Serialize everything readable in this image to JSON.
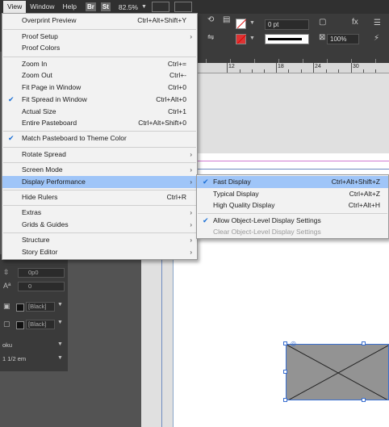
{
  "menubar": {
    "items": [
      "View",
      "Window",
      "Help"
    ],
    "badges": [
      "Br",
      "St"
    ],
    "zoom": "82.5%"
  },
  "controlbar": {
    "stroke_weight": "0 pt",
    "scale_pct": "100%"
  },
  "ruler": {
    "labels": [
      "12",
      "18",
      "24",
      "30"
    ]
  },
  "view_menu": [
    {
      "label": "Overprint Preview",
      "shortcut": "Ctrl+Alt+Shift+Y"
    },
    {
      "label": "Proof Setup",
      "submenu": true
    },
    {
      "label": "Proof Colors"
    },
    {
      "label": "Zoom In",
      "shortcut": "Ctrl+="
    },
    {
      "label": "Zoom Out",
      "shortcut": "Ctrl+-"
    },
    {
      "label": "Fit Page in Window",
      "shortcut": "Ctrl+0"
    },
    {
      "label": "Fit Spread in Window",
      "shortcut": "Ctrl+Alt+0",
      "checked": true
    },
    {
      "label": "Actual Size",
      "shortcut": "Ctrl+1"
    },
    {
      "label": "Entire Pasteboard",
      "shortcut": "Ctrl+Alt+Shift+0"
    },
    {
      "label": "Match Pasteboard to Theme Color",
      "checked": true
    },
    {
      "label": "Rotate Spread",
      "submenu": true
    },
    {
      "label": "Screen Mode",
      "submenu": true
    },
    {
      "label": "Display Performance",
      "submenu": true,
      "highlighted": true
    },
    {
      "label": "Hide Rulers",
      "shortcut": "Ctrl+R"
    },
    {
      "label": "Extras",
      "submenu": true
    },
    {
      "label": "Grids & Guides",
      "submenu": true
    },
    {
      "label": "Structure",
      "submenu": true
    },
    {
      "label": "Story Editor",
      "submenu": true
    }
  ],
  "display_performance_menu": [
    {
      "label": "Fast Display",
      "shortcut": "Ctrl+Alt+Shift+Z",
      "checked": true,
      "highlighted": true
    },
    {
      "label": "Typical Display",
      "shortcut": "Ctrl+Alt+Z"
    },
    {
      "label": "High Quality Display",
      "shortcut": "Ctrl+Alt+H"
    },
    {
      "label": "Allow Object-Level Display Settings",
      "checked": true
    },
    {
      "label": "Clear Object-Level Display Settings",
      "disabled": true
    }
  ],
  "panel": {
    "field1": "0p0",
    "field2": "0",
    "swatch1": "[Black]",
    "swatch2": "[Black]",
    "label1": "oku",
    "label2": "1 1/2 em"
  },
  "colors": {
    "highlight": "#9fc5f8",
    "check": "#1a6fd6",
    "frame_fill": "#939393",
    "selection": "#3a6fd0"
  },
  "icons": {
    "submenu_arrow": "chevron-right-icon",
    "checkmark": "checkmark-icon"
  }
}
